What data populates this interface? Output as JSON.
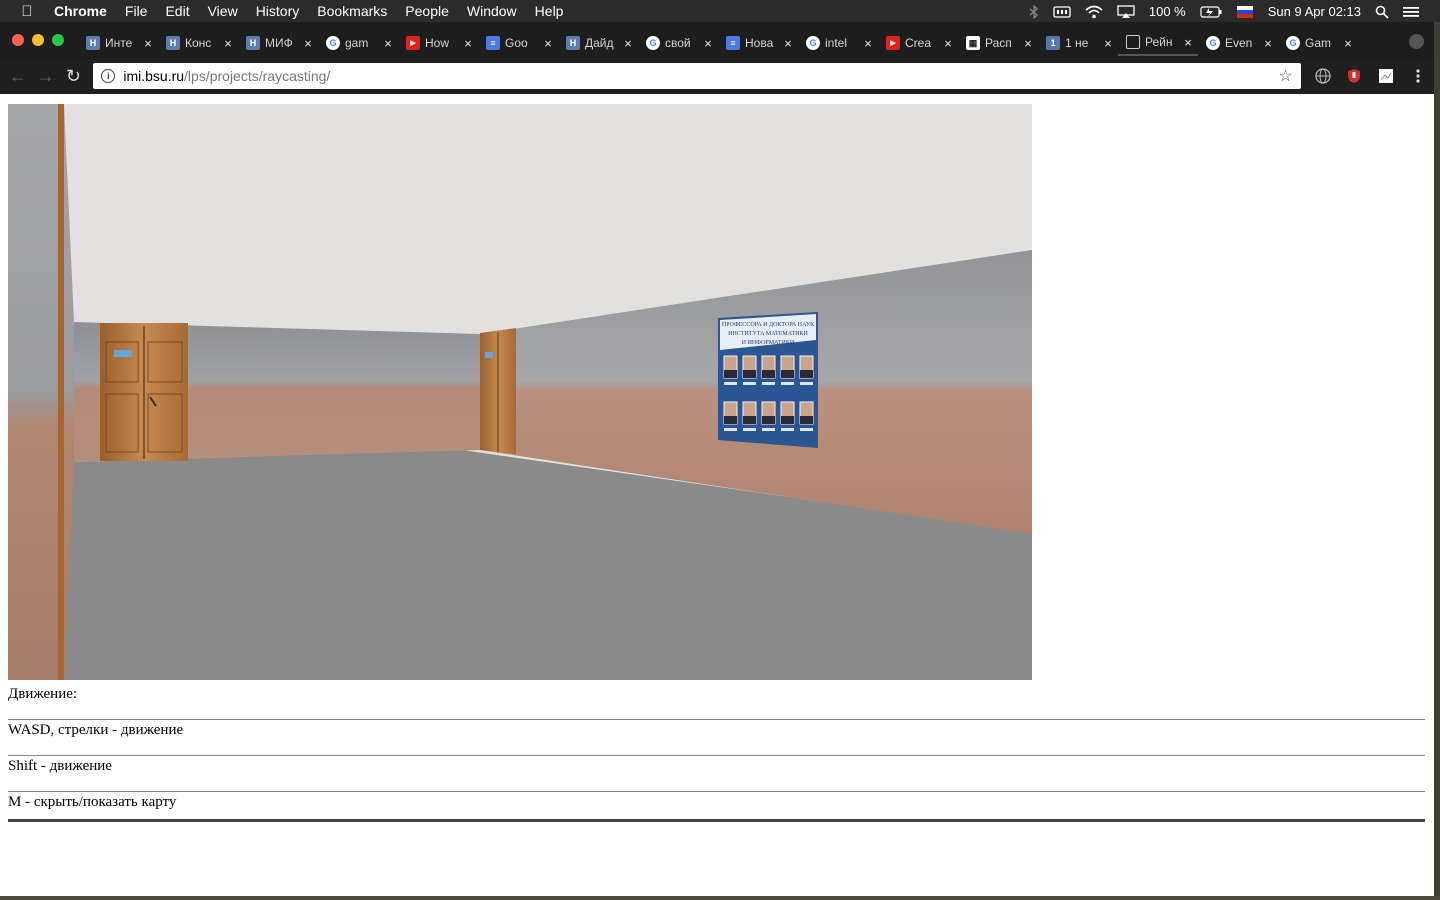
{
  "menubar": {
    "app": "Chrome",
    "menus": [
      "File",
      "Edit",
      "View",
      "History",
      "Bookmarks",
      "People",
      "Window",
      "Help"
    ],
    "battery": "100 %",
    "datetime": "Sun 9 Apr  02:13"
  },
  "tabs": [
    {
      "title": "Инте",
      "favicon": "H",
      "color": "#5b7fae"
    },
    {
      "title": "Конс",
      "favicon": "H",
      "color": "#5b7fae"
    },
    {
      "title": "МИФ",
      "favicon": "H",
      "color": "#5b7fae"
    },
    {
      "title": "gam",
      "favicon": "google-icon",
      "color": "#4285f4"
    },
    {
      "title": "How",
      "favicon": "youtube-icon",
      "color": "#e62117"
    },
    {
      "title": "Goo",
      "favicon": "translate-icon",
      "color": "#4a7be8"
    },
    {
      "title": "Дайд",
      "favicon": "H",
      "color": "#5b7fae"
    },
    {
      "title": "свой",
      "favicon": "google-icon",
      "color": "#4285f4"
    },
    {
      "title": "Нова",
      "favicon": "docs-icon",
      "color": "#4a7be8"
    },
    {
      "title": "intel",
      "favicon": "google-icon",
      "color": "#4285f4"
    },
    {
      "title": "Crea",
      "favicon": "youtube-icon",
      "color": "#e62117"
    },
    {
      "title": "Расп",
      "favicon": "schedule-icon",
      "color": "#ffffff"
    },
    {
      "title": "1 не",
      "favicon": "1",
      "color": "#5577aa"
    },
    {
      "title": "Рейн",
      "favicon": "page-icon",
      "color": "#dddddd"
    },
    {
      "title": "Even",
      "favicon": "google-icon",
      "color": "#4285f4"
    },
    {
      "title": "Gam",
      "favicon": "google-icon",
      "color": "#4285f4"
    }
  ],
  "address": {
    "host": "imi.bsu.ru",
    "path": "/lps/projects/raycasting/"
  },
  "poster": {
    "title_line1": "ПРОФЕССОРА И ДОКТОРА НАУК",
    "title_line2": "ИНСТИТУТА МАТЕМАТИКИ",
    "title_line3": "И ИНФОРМАТИКИ"
  },
  "controls": {
    "heading": "Движение:",
    "items": [
      "WASD, стрелки - движение",
      "Shift - движение",
      "M - скрыть/показать карту"
    ]
  },
  "colors": {
    "ceiling": "#e2e1df",
    "floor": "#8a8a8a",
    "wall_upper": "#9b9c9e",
    "wall_lower": "#b78d7a",
    "door": "#b67a3e",
    "poster": "#2c5593"
  }
}
